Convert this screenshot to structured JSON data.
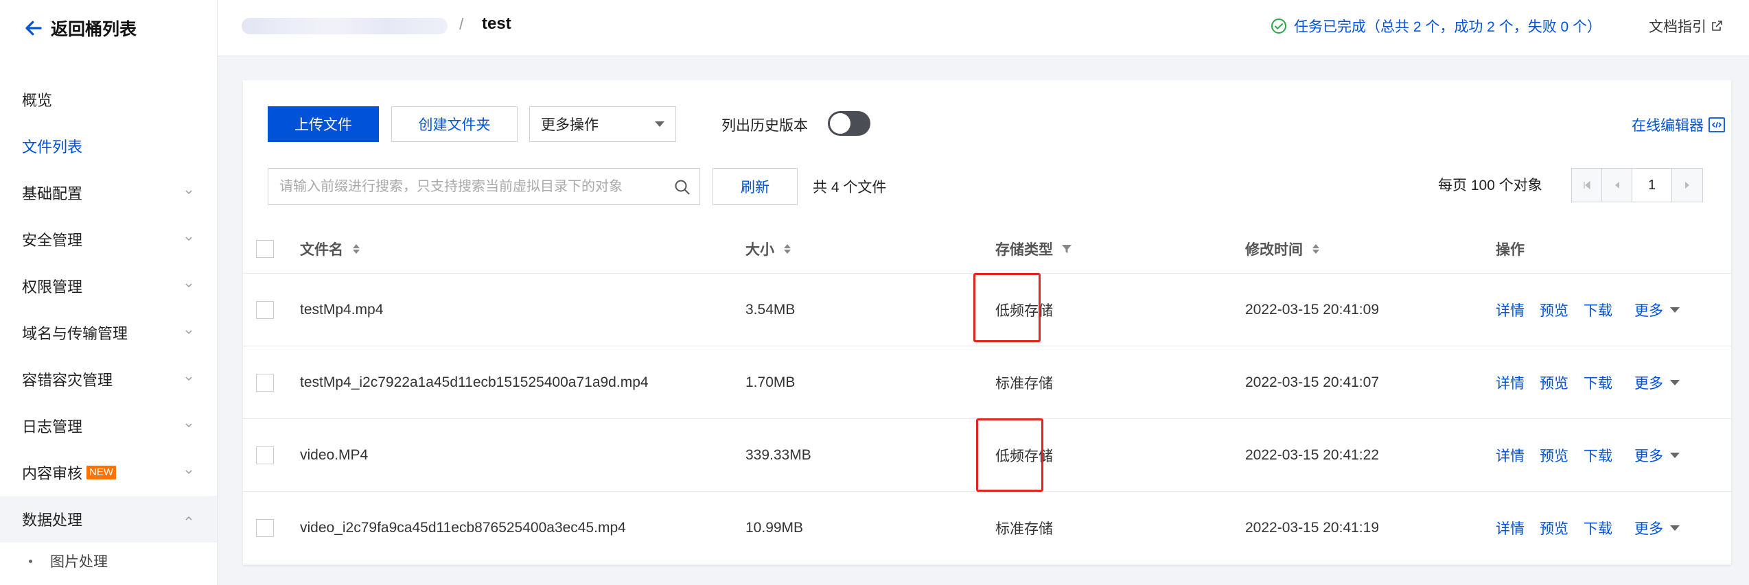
{
  "sidebar": {
    "back_label": "返回桶列表",
    "items": [
      {
        "label": "概览"
      },
      {
        "label": "文件列表"
      },
      {
        "label": "基础配置"
      },
      {
        "label": "安全管理"
      },
      {
        "label": "权限管理"
      },
      {
        "label": "域名与传输管理"
      },
      {
        "label": "容错容灾管理"
      },
      {
        "label": "日志管理"
      },
      {
        "label": "内容审核",
        "badge": "NEW"
      },
      {
        "label": "数据处理"
      }
    ],
    "sub_items": [
      {
        "label": "图片处理"
      }
    ]
  },
  "header": {
    "breadcrumb_sep": "/",
    "bucket_name": "test",
    "task_status": "任务已完成（总共 2 个，成功 2 个，失败 0 个）",
    "doc_link": "文档指引"
  },
  "toolbar": {
    "upload_label": "上传文件",
    "create_folder_label": "创建文件夹",
    "more_ops_label": "更多操作",
    "history_label": "列出历史版本",
    "online_editor_label": "在线编辑器",
    "search_placeholder": "请输入前缀进行搜索，只支持搜索当前虚拟目录下的对象",
    "refresh_label": "刷新",
    "file_count": "共 4 个文件",
    "per_page": "每页 100 个对象",
    "page_number": "1"
  },
  "table": {
    "headers": {
      "name": "文件名",
      "size": "大小",
      "storage_type": "存储类型",
      "modified": "修改时间",
      "ops": "操作"
    },
    "rows": [
      {
        "name": "testMp4.mp4",
        "size": "3.54MB",
        "storage_type": "低频存储",
        "modified": "2022-03-15 20:41:09"
      },
      {
        "name": "testMp4_i2c7922a1a45d11ecb151525400a71a9d.mp4",
        "size": "1.70MB",
        "storage_type": "标准存储",
        "modified": "2022-03-15 20:41:07"
      },
      {
        "name": "video.MP4",
        "size": "339.33MB",
        "storage_type": "低频存储",
        "modified": "2022-03-15 20:41:22"
      },
      {
        "name": "video_i2c79fa9ca45d11ecb876525400a3ec45.mp4",
        "size": "10.99MB",
        "storage_type": "标准存储",
        "modified": "2022-03-15 20:41:19"
      }
    ],
    "ops": {
      "detail": "详情",
      "preview": "预览",
      "download": "下载",
      "more": "更多"
    }
  },
  "colors": {
    "accent": "#0052d9",
    "success": "#29a947",
    "highlight": "#e5231d"
  }
}
